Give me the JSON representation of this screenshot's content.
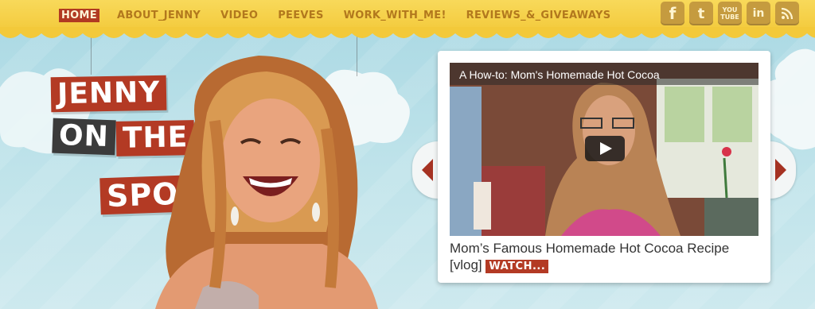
{
  "nav": {
    "items": [
      {
        "label": "HOME",
        "active": true
      },
      {
        "label": "ABOUT_JENNY",
        "active": false
      },
      {
        "label": "VIDEO",
        "active": false
      },
      {
        "label": "PEEVES",
        "active": false
      },
      {
        "label": "WORK_WITH_ME!",
        "active": false
      },
      {
        "label": "REVIEWS_&_GIVEAWAYS",
        "active": false
      }
    ]
  },
  "social": {
    "facebook": "f",
    "twitter": "t",
    "youtube_top": "YOU",
    "youtube_bottom": "TUBE",
    "linkedin": "in",
    "rss_icon": "rss-icon"
  },
  "logo": {
    "line1": "JENNY",
    "line2a": "ON",
    "line2b": "THE",
    "line3": "SPOT"
  },
  "featured": {
    "video_title": "A How-to: Mom's Homemade Hot Cocoa",
    "caption": "Mom’s Famous Homemade Hot Cocoa Recipe [vlog]",
    "watch_label": "WATCH..."
  },
  "colors": {
    "accent_red": "#b33a24",
    "nav_yellow": "#f3c93a",
    "nav_text": "#b2781d",
    "sky": "#a9d8e3"
  }
}
